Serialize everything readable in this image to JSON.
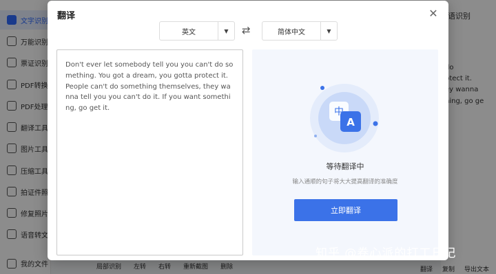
{
  "app": {
    "sidebar": {
      "items": [
        {
          "label": "文字识别",
          "active": true
        },
        {
          "label": "万能识别"
        },
        {
          "label": "票证识别"
        },
        {
          "label": "PDF转换"
        },
        {
          "label": "PDF处理"
        },
        {
          "label": "翻译工具"
        },
        {
          "label": "图片工具"
        },
        {
          "label": "压缩工具"
        },
        {
          "label": "拍证件照"
        },
        {
          "label": "修复照片"
        },
        {
          "label": "语音转文"
        }
      ],
      "my_files": "我的文件"
    },
    "right_tab": "语识别",
    "right_text": "do\nptect it.\ney wanna\nhing, go ge",
    "bottom_tools": [
      "局部识别",
      "左转",
      "右转",
      "重新截图",
      "删除"
    ],
    "bottom_actions": [
      "翻译",
      "复制",
      "导出文本"
    ]
  },
  "modal": {
    "title": "翻译",
    "source_lang": "英文",
    "target_lang": "简体中文",
    "source_text": "Don't ever let somebody tell you you can't do something. You got a dream, you gotta protect it. People can't do something themselves, they wanna tell you you can't do it. If you want something, go get it.",
    "status_title": "等待翻译中",
    "status_sub": "输入通顺的句子将大大提高翻译的准确度",
    "translate_button": "立即翻译"
  },
  "watermark": "知乎 @卷心派的打工日记",
  "colors": {
    "accent": "#3b72e8",
    "result_bg": "#f4f7fd"
  }
}
